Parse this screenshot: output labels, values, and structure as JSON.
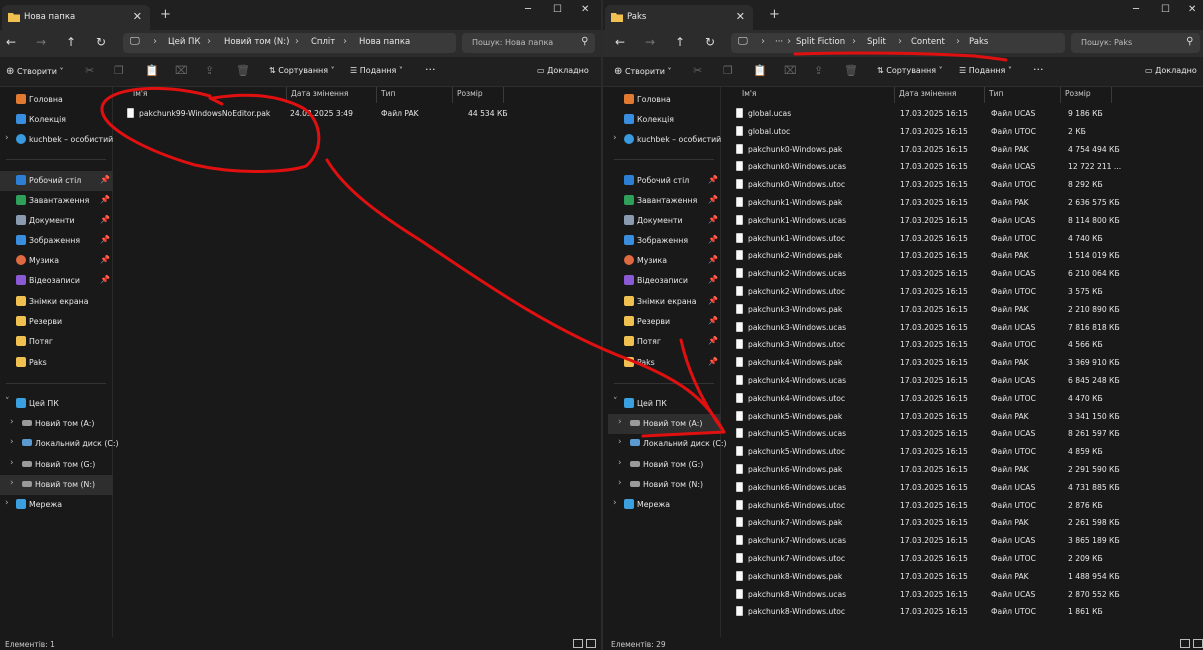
{
  "left": {
    "tab_title": "Нова папка",
    "breadcrumbs": [
      "Цей ПК",
      "Новий том (N:)",
      "Спліт",
      "Нова папка"
    ],
    "search_placeholder": "Пошук: Нова папка",
    "toolbar": {
      "create": "Створити",
      "sort": "Сортування",
      "view": "Подання",
      "details": "Докладно"
    },
    "columns": {
      "name": "Ім'я",
      "date": "Дата змінення",
      "type": "Тип",
      "size": "Розмір"
    },
    "files": [
      {
        "name": "pakchunk99-WindowsNoEditor.pak",
        "date": "24.03.2025 3:49",
        "type": "Файл PAK",
        "size": "44 534 КБ"
      }
    ],
    "sidebar": {
      "home": "Головна",
      "gallery": "Колекція",
      "onedrive": "kuchbek – особистий",
      "quick": [
        "Робочий стіл",
        "Завантаження",
        "Документи",
        "Зображення",
        "Музика",
        "Відеозаписи",
        "Знімки екрана",
        "Резерви",
        "Потяг",
        "Paks"
      ],
      "this_pc": "Цей ПК",
      "drives": [
        "Новий том (A:)",
        "Локальний диск (C:)",
        "Новий том (G:)",
        "Новий том (N:)"
      ],
      "network": "Мережа"
    },
    "status": "Елементів: 1"
  },
  "right": {
    "tab_title": "Paks",
    "breadcrumbs": [
      "Split Fiction",
      "Split",
      "Content",
      "Paks"
    ],
    "ellipsis": "···",
    "search_placeholder": "Пошук: Paks",
    "toolbar": {
      "create": "Створити",
      "sort": "Сортування",
      "view": "Подання",
      "details": "Докладно"
    },
    "columns": {
      "name": "Ім'я",
      "date": "Дата змінення",
      "type": "Тип",
      "size": "Розмір"
    },
    "files": [
      {
        "name": "global.ucas",
        "date": "17.03.2025 16:15",
        "type": "Файл UCAS",
        "size": "9 186 КБ"
      },
      {
        "name": "global.utoc",
        "date": "17.03.2025 16:15",
        "type": "Файл UTOC",
        "size": "2 КБ"
      },
      {
        "name": "pakchunk0-Windows.pak",
        "date": "17.03.2025 16:15",
        "type": "Файл PAK",
        "size": "4 754 494 КБ"
      },
      {
        "name": "pakchunk0-Windows.ucas",
        "date": "17.03.2025 16:15",
        "type": "Файл UCAS",
        "size": "12 722 211 ..."
      },
      {
        "name": "pakchunk0-Windows.utoc",
        "date": "17.03.2025 16:15",
        "type": "Файл UTOC",
        "size": "8 292 КБ"
      },
      {
        "name": "pakchunk1-Windows.pak",
        "date": "17.03.2025 16:15",
        "type": "Файл PAK",
        "size": "2 636 575 КБ"
      },
      {
        "name": "pakchunk1-Windows.ucas",
        "date": "17.03.2025 16:15",
        "type": "Файл UCAS",
        "size": "8 114 800 КБ"
      },
      {
        "name": "pakchunk1-Windows.utoc",
        "date": "17.03.2025 16:15",
        "type": "Файл UTOC",
        "size": "4 740 КБ"
      },
      {
        "name": "pakchunk2-Windows.pak",
        "date": "17.03.2025 16:15",
        "type": "Файл PAK",
        "size": "1 514 019 КБ"
      },
      {
        "name": "pakchunk2-Windows.ucas",
        "date": "17.03.2025 16:15",
        "type": "Файл UCAS",
        "size": "6 210 064 КБ"
      },
      {
        "name": "pakchunk2-Windows.utoc",
        "date": "17.03.2025 16:15",
        "type": "Файл UTOC",
        "size": "3 575 КБ"
      },
      {
        "name": "pakchunk3-Windows.pak",
        "date": "17.03.2025 16:15",
        "type": "Файл PAK",
        "size": "2 210 890 КБ"
      },
      {
        "name": "pakchunk3-Windows.ucas",
        "date": "17.03.2025 16:15",
        "type": "Файл UCAS",
        "size": "7 816 818 КБ"
      },
      {
        "name": "pakchunk3-Windows.utoc",
        "date": "17.03.2025 16:15",
        "type": "Файл UTOC",
        "size": "4 566 КБ"
      },
      {
        "name": "pakchunk4-Windows.pak",
        "date": "17.03.2025 16:15",
        "type": "Файл PAK",
        "size": "3 369 910 КБ"
      },
      {
        "name": "pakchunk4-Windows.ucas",
        "date": "17.03.2025 16:15",
        "type": "Файл UCAS",
        "size": "6 845 248 КБ"
      },
      {
        "name": "pakchunk4-Windows.utoc",
        "date": "17.03.2025 16:15",
        "type": "Файл UTOC",
        "size": "4 470 КБ"
      },
      {
        "name": "pakchunk5-Windows.pak",
        "date": "17.03.2025 16:15",
        "type": "Файл PAK",
        "size": "3 341 150 КБ"
      },
      {
        "name": "pakchunk5-Windows.ucas",
        "date": "17.03.2025 16:15",
        "type": "Файл UCAS",
        "size": "8 261 597 КБ"
      },
      {
        "name": "pakchunk5-Windows.utoc",
        "date": "17.03.2025 16:15",
        "type": "Файл UTOC",
        "size": "4 859 КБ"
      },
      {
        "name": "pakchunk6-Windows.pak",
        "date": "17.03.2025 16:15",
        "type": "Файл PAK",
        "size": "2 291 590 КБ"
      },
      {
        "name": "pakchunk6-Windows.ucas",
        "date": "17.03.2025 16:15",
        "type": "Файл UCAS",
        "size": "4 731 885 КБ"
      },
      {
        "name": "pakchunk6-Windows.utoc",
        "date": "17.03.2025 16:15",
        "type": "Файл UTOC",
        "size": "2 876 КБ"
      },
      {
        "name": "pakchunk7-Windows.pak",
        "date": "17.03.2025 16:15",
        "type": "Файл PAK",
        "size": "2 261 598 КБ"
      },
      {
        "name": "pakchunk7-Windows.ucas",
        "date": "17.03.2025 16:15",
        "type": "Файл UCAS",
        "size": "3 865 189 КБ"
      },
      {
        "name": "pakchunk7-Windows.utoc",
        "date": "17.03.2025 16:15",
        "type": "Файл UTOC",
        "size": "2 209 КБ"
      },
      {
        "name": "pakchunk8-Windows.pak",
        "date": "17.03.2025 16:15",
        "type": "Файл PAK",
        "size": "1 488 954 КБ"
      },
      {
        "name": "pakchunk8-Windows.ucas",
        "date": "17.03.2025 16:15",
        "type": "Файл UCAS",
        "size": "2 870 552 КБ"
      },
      {
        "name": "pakchunk8-Windows.utoc",
        "date": "17.03.2025 16:15",
        "type": "Файл UTOC",
        "size": "1 861 КБ"
      }
    ],
    "sidebar": {
      "home": "Головна",
      "gallery": "Колекція",
      "onedrive": "kuchbek – особистий",
      "quick": [
        "Робочий стіл",
        "Завантаження",
        "Документи",
        "Зображення",
        "Музика",
        "Відеозаписи",
        "Знімки екрана",
        "Резерви",
        "Потяг",
        "Paks"
      ],
      "this_pc": "Цей ПК",
      "drives": [
        "Новий том (A:)",
        "Локальний диск (C:)",
        "Новий том (G:)",
        "Новий том (N:)"
      ],
      "network": "Мережа"
    },
    "status": "Елементів: 29"
  },
  "colors": {
    "annotation": "#e01010",
    "folder": "#f0c050",
    "background": "#191919"
  }
}
